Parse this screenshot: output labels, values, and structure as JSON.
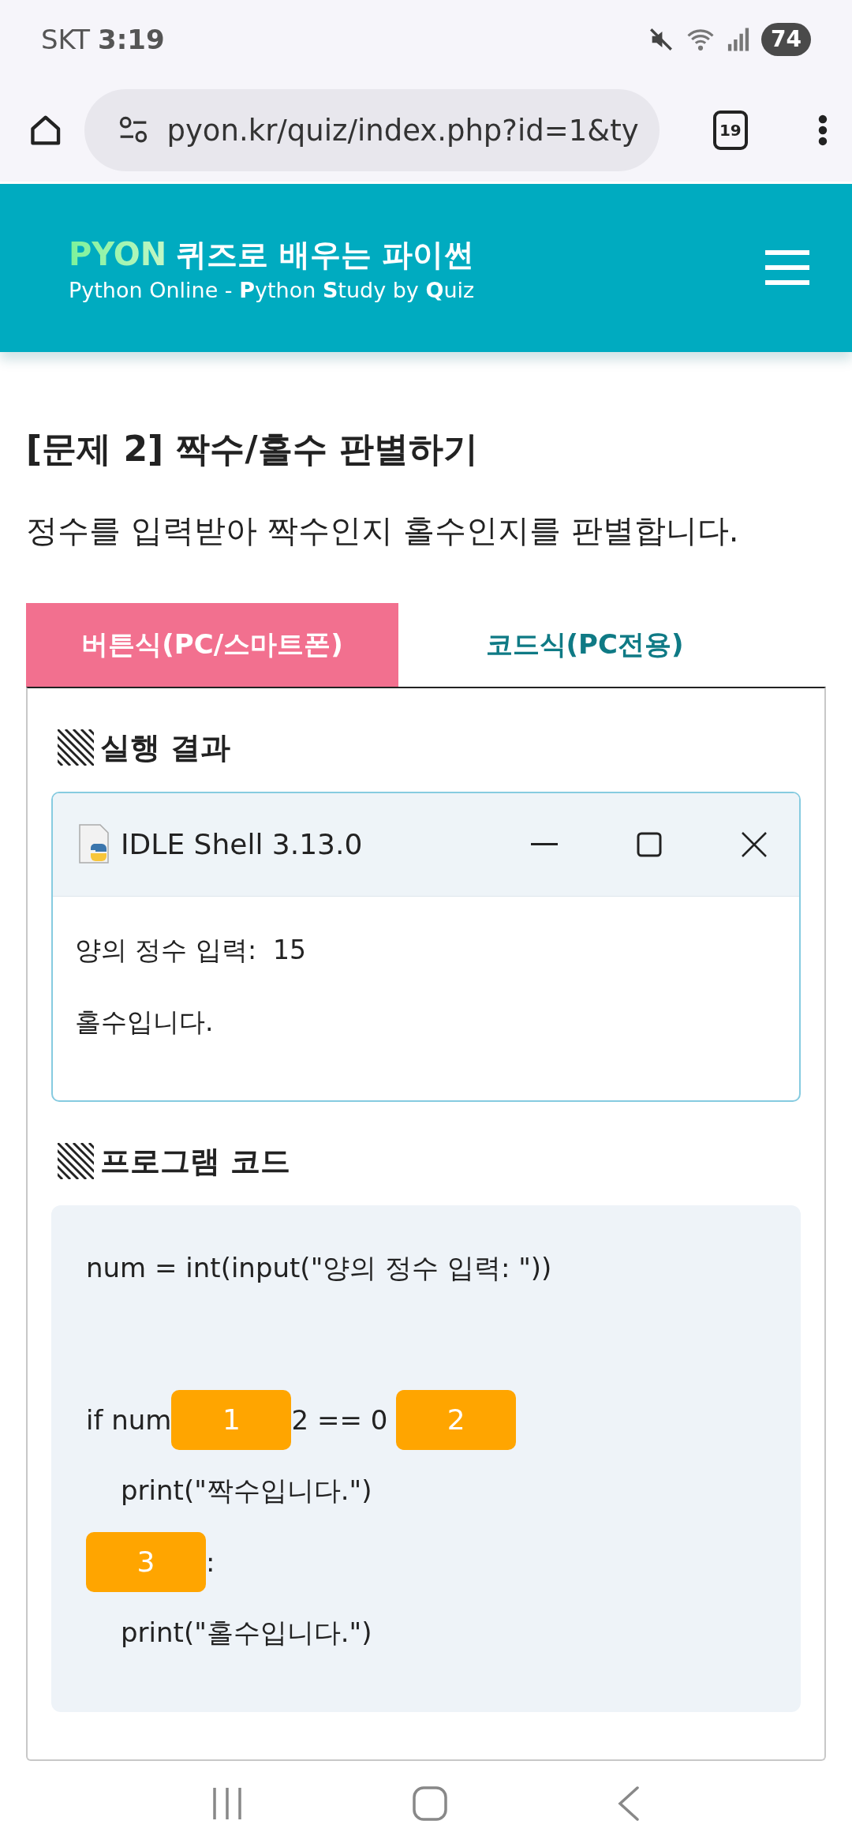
{
  "status_bar": {
    "carrier": "SKT",
    "time": "3:19",
    "battery": "74"
  },
  "browser": {
    "url": "pyon.kr/quiz/index.php?id=1&ty",
    "tab_count": "19"
  },
  "site_header": {
    "brand": "PYON",
    "tagline": "퀴즈로 배우는 파이썬",
    "subtitle": "Python Online - **P**ython **S**tudy by **Q**uiz"
  },
  "quiz": {
    "title": "[문제 2] 짝수/홀수 판별하기",
    "description": "정수를 입력받아 짝수인지 홀수인지를 판별합니다."
  },
  "tabs": [
    {
      "label": "버튼식(PC/스마트폰)",
      "selected": true
    },
    {
      "label": "코드식(PC전용)",
      "selected": false
    }
  ],
  "result": {
    "heading": "실행 결과",
    "window_title": "IDLE Shell 3.13.0",
    "output": [
      "양의 정수 입력:  15",
      "홀수입니다."
    ]
  },
  "code": {
    "heading": "프로그램 코드",
    "lines": [
      {
        "kind": "plain",
        "parts": [
          {
            "kind": "text",
            "text": "num = int(input(\"양의 정수 입력: \"))"
          }
        ]
      },
      {
        "kind": "empty"
      },
      {
        "kind": "plain",
        "parts": [
          {
            "kind": "text",
            "text": "if num"
          },
          {
            "kind": "blank",
            "text": "1"
          },
          {
            "kind": "text",
            "text": "2 == 0 "
          },
          {
            "kind": "blank",
            "text": "2"
          }
        ]
      },
      {
        "kind": "indented",
        "parts": [
          {
            "kind": "text",
            "text": "print(\"짝수입니다.\")"
          }
        ]
      },
      {
        "kind": "plain",
        "parts": [
          {
            "kind": "blank",
            "text": "3"
          },
          {
            "kind": "text",
            "text": ":"
          }
        ]
      },
      {
        "kind": "indented",
        "parts": [
          {
            "kind": "text",
            "text": "print(\"홀수입니다.\")"
          }
        ]
      }
    ]
  }
}
